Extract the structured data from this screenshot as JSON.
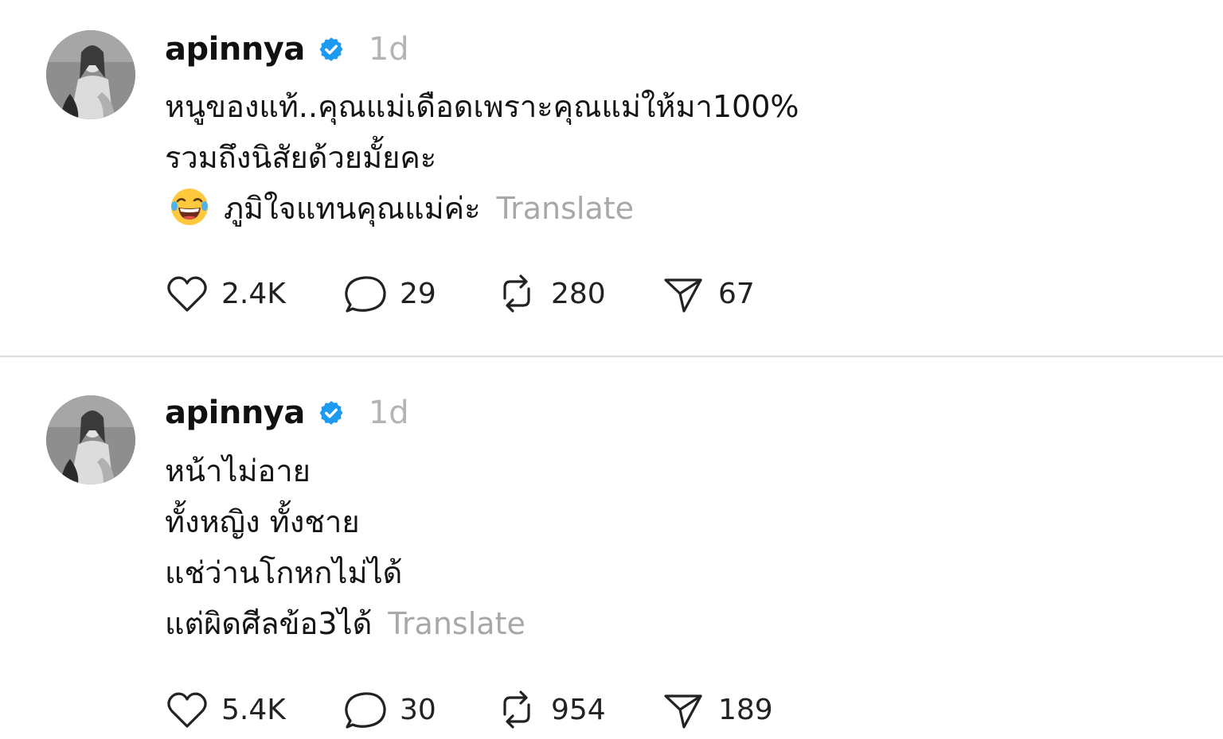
{
  "posts": [
    {
      "username": "apinnya",
      "time": "1d",
      "text_lines": [
        "หนูของแท้..คุณแม่เดือดเพราะคุณแม่ให้มา100%",
        "รวมถึงนิสัยด้วยมั้ยคะ",
        "ภูมิใจแทนคุณแม่ค่ะ"
      ],
      "emoji_icon": "laughing-face-emoji",
      "translate_label": "Translate",
      "likes": "2.4K",
      "replies": "29",
      "reposts": "280",
      "shares": "67"
    },
    {
      "username": "apinnya",
      "time": "1d",
      "text_lines": [
        "หน้าไม่อาย",
        "ทั้งหญิง ทั้งชาย",
        "แช่ว่านโกหกไม่ได้",
        "แต่ผิดศีลข้อ3ได้"
      ],
      "translate_label": "Translate",
      "likes": "5.4K",
      "replies": "30",
      "reposts": "954",
      "shares": "189"
    }
  ],
  "colors": {
    "verified_badge": "#1d9bf0",
    "muted_text": "#a8a8a8",
    "divider": "#dcdcdc"
  }
}
